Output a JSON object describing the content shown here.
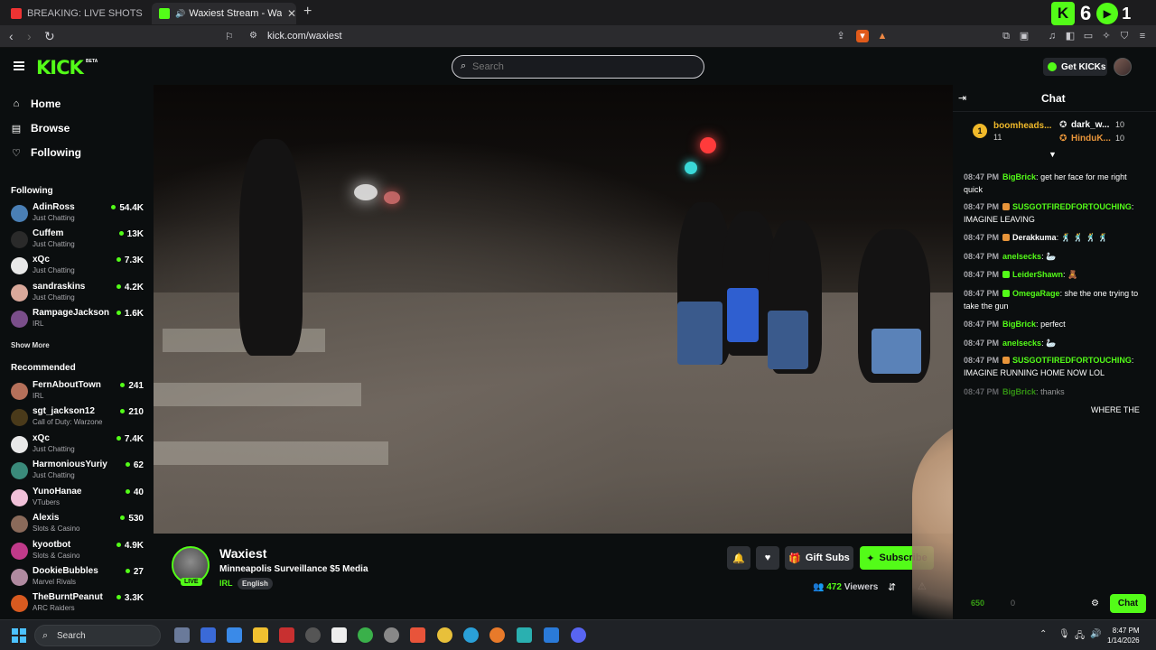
{
  "browser": {
    "tabs": [
      {
        "title": "BREAKING: LIVE SHOTS FIRED Amid",
        "active": false
      },
      {
        "title": "Waxiest Stream - Watch Live o",
        "active": true
      }
    ],
    "new_tab": "+",
    "url": "kick.com/waxiest"
  },
  "overlay": {
    "count": "6",
    "count2": "1"
  },
  "header": {
    "logo": "KICK",
    "beta": "BETA",
    "search_placeholder": "Search",
    "get_kicks": "Get KICKs"
  },
  "sidebar": {
    "nav": [
      {
        "label": "Home",
        "icon": "home-icon"
      },
      {
        "label": "Browse",
        "icon": "browse-icon"
      },
      {
        "label": "Following",
        "icon": "heart-icon"
      }
    ],
    "following_title": "Following",
    "following": [
      {
        "name": "AdinRoss",
        "category": "Just Chatting",
        "viewers": "54.4K",
        "color": "#4a7fb5"
      },
      {
        "name": "Cuffem",
        "category": "Just Chatting",
        "viewers": "13K",
        "color": "#2a2a2a"
      },
      {
        "name": "xQc",
        "category": "Just Chatting",
        "viewers": "7.3K",
        "color": "#e8e8e8"
      },
      {
        "name": "sandraskins",
        "category": "Just Chatting",
        "viewers": "4.2K",
        "color": "#d9a89a"
      },
      {
        "name": "RampageJackson",
        "category": "IRL",
        "viewers": "1.6K",
        "color": "#7a4e8a"
      }
    ],
    "show_more": "Show More",
    "recommended_title": "Recommended",
    "recommended": [
      {
        "name": "FernAboutTown",
        "category": "IRL",
        "viewers": "241",
        "color": "#b5705a"
      },
      {
        "name": "sgt_jackson12",
        "category": "Call of Duty: Warzone",
        "viewers": "210",
        "color": "#4a3a1a"
      },
      {
        "name": "xQc",
        "category": "Just Chatting",
        "viewers": "7.4K",
        "color": "#e8e8e8"
      },
      {
        "name": "HarmoniousYuriy",
        "category": "Just Chatting",
        "viewers": "62",
        "color": "#3a8a7a"
      },
      {
        "name": "YunoHanae",
        "category": "VTubers",
        "viewers": "40",
        "color": "#f0c0d8"
      },
      {
        "name": "Alexis",
        "category": "Slots & Casino",
        "viewers": "530",
        "color": "#8a6a5a"
      },
      {
        "name": "kyootbot",
        "category": "Slots & Casino",
        "viewers": "4.9K",
        "color": "#c03a8a"
      },
      {
        "name": "DookieBubbles",
        "category": "Marvel Rivals",
        "viewers": "27",
        "color": "#b08aa0"
      },
      {
        "name": "TheBurntPeanut",
        "category": "ARC Raiders",
        "viewers": "3.3K",
        "color": "#d85a20"
      }
    ]
  },
  "stream": {
    "name": "Waxiest",
    "title": "Minneapolis Surveillance $5 Media",
    "category": "IRL",
    "language": "English",
    "live": "LIVE",
    "gift_subs": "Gift Subs",
    "subscribe": "Subscribe",
    "viewer_count": "472",
    "viewers_label": "Viewers"
  },
  "chat": {
    "title": "Chat",
    "leaders": [
      {
        "rank": "1",
        "name": "boomheads...",
        "value": "11"
      },
      {
        "name": "dark_w...",
        "value": "10"
      },
      {
        "name": "HinduK...",
        "value": "10"
      }
    ],
    "messages": [
      {
        "time": "08:47 PM",
        "user": "BigBrick",
        "color": "#53fc18",
        "badge": "",
        "text": "get her face for me right quick"
      },
      {
        "time": "08:47 PM",
        "user": "SUSGOTFIREDFORTOUCHING",
        "color": "#53fc18",
        "badge": "#e8953a",
        "text": "IMAGINE LEAVING"
      },
      {
        "time": "08:47 PM",
        "user": "Derakkuma",
        "color": "#fff",
        "badge": "#e8953a",
        "text": "🕺 🕺 🕺 🕺"
      },
      {
        "time": "08:47 PM",
        "user": "anelsecks",
        "color": "#53fc18",
        "badge": "",
        "text": "🦢"
      },
      {
        "time": "08:47 PM",
        "user": "LeiderShawn",
        "color": "#53fc18",
        "badge": "#53fc18",
        "text": "🧸"
      },
      {
        "time": "08:47 PM",
        "user": "OmegaRage",
        "color": "#53fc18",
        "badge": "#53fc18",
        "text": "she the one trying to take the gun"
      },
      {
        "time": "08:47 PM",
        "user": "BigBrick",
        "color": "#53fc18",
        "badge": "",
        "text": "perfect"
      },
      {
        "time": "08:47 PM",
        "user": "anelsecks",
        "color": "#53fc18",
        "badge": "",
        "text": "🦢"
      },
      {
        "time": "08:47 PM",
        "user": "SUSGOTFIREDFORTOUCHING",
        "color": "#53fc18",
        "badge": "#e8953a",
        "text": "IMAGINE RUNNING HOME NOW LOL"
      },
      {
        "time": "08:47 PM",
        "user": "BigBrick",
        "color": "#53fc18",
        "badge": "",
        "text": "thanks"
      },
      {
        "time": "",
        "user": "",
        "color": "#fff",
        "badge": "",
        "text": "WHERE THE"
      }
    ],
    "points": "650",
    "points2": "0",
    "send": "Chat"
  },
  "taskbar": {
    "search": "Search",
    "time": "8:47 PM",
    "date": "1/14/2026"
  }
}
